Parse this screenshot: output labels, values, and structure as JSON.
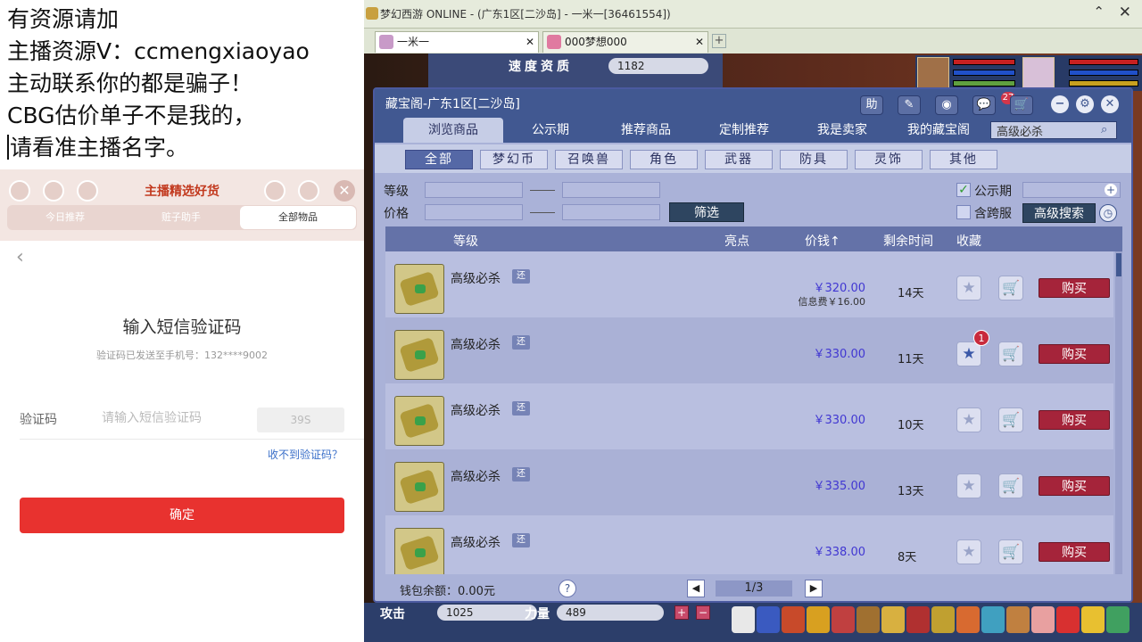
{
  "overlay": {
    "notice_lines": [
      "有资源请加",
      "主播资源V：ccmengxiaoyao",
      "主动联系你的都是骗子！",
      "CBG估价单子不是我的，",
      "请看准主播名字。"
    ],
    "promo_title": "主播精选好货",
    "promo_tabs": [
      "今日推荐",
      "赃子助手",
      "全部物品"
    ],
    "sms": {
      "title": "输入短信验证码",
      "subtitle": "验证码已发送至手机号：132****9002",
      "code_label": "验证码",
      "code_placeholder": "请输入短信验证码",
      "countdown": "39S",
      "no_code_link": "收不到验证码？",
      "confirm": "确定"
    }
  },
  "game": {
    "window_title": "梦幻西游 ONLINE - (广东1区[二沙岛] - 一米一[36461554])",
    "tabs": [
      {
        "label": "一米一",
        "active": true
      },
      {
        "label": "000梦想000",
        "active": false
      }
    ],
    "speed_label": "速度资质",
    "speed_value": "1182",
    "bottom_stats": [
      {
        "label": "攻击",
        "value": "1025"
      },
      {
        "label": "力量",
        "value": "489"
      }
    ]
  },
  "treasure": {
    "title": "藏宝阁-广东1区[二沙岛]",
    "header_buttons": [
      "助",
      "✎",
      "◉",
      "💬"
    ],
    "notify_count": "27",
    "nav_tabs": [
      "浏览商品",
      "公示期",
      "推荐商品",
      "定制推荐",
      "我是卖家",
      "我的藏宝阁"
    ],
    "active_nav": 0,
    "search_value": "高级必杀",
    "categories": [
      "全部",
      "梦幻币",
      "召唤兽",
      "角色",
      "武器",
      "防具",
      "灵饰",
      "其他"
    ],
    "active_category": 0,
    "filter": {
      "level_label": "等级",
      "price_label": "价格",
      "filter_button": "筛选",
      "public_label": "公示期",
      "public_checked": true,
      "cross_label": "含跨服",
      "cross_checked": false,
      "advanced_search": "高级搜索"
    },
    "columns": [
      "等级",
      "亮点",
      "价钱↑",
      "剩余时间",
      "收藏"
    ],
    "items": [
      {
        "name": "高级必杀",
        "tag": "还",
        "price": "￥320.00",
        "info_fee": "信息费￥16.00",
        "days": "14天",
        "favorited": false,
        "fav_badge": "",
        "buy": "购买"
      },
      {
        "name": "高级必杀",
        "tag": "还",
        "price": "￥330.00",
        "info_fee": "",
        "days": "11天",
        "favorited": true,
        "fav_badge": "1",
        "buy": "购买"
      },
      {
        "name": "高级必杀",
        "tag": "还",
        "price": "￥330.00",
        "info_fee": "",
        "days": "10天",
        "favorited": false,
        "fav_badge": "",
        "buy": "购买"
      },
      {
        "name": "高级必杀",
        "tag": "还",
        "price": "￥335.00",
        "info_fee": "",
        "days": "13天",
        "favorited": false,
        "fav_badge": "",
        "buy": "购买"
      },
      {
        "name": "高级必杀",
        "tag": "还",
        "price": "￥338.00",
        "info_fee": "",
        "days": "8天",
        "favorited": false,
        "fav_badge": "",
        "buy": "购买"
      }
    ],
    "wallet": "钱包余额：0.00元",
    "page": "1/3"
  },
  "colors": {
    "accent_blue": "#415891",
    "buy_red": "#a5243a",
    "confirm_red": "#e8322f",
    "price_blue": "#4137d2"
  }
}
